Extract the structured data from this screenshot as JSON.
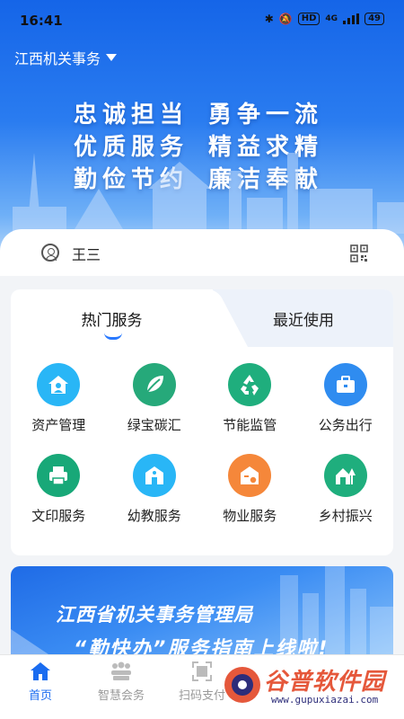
{
  "status": {
    "time": "16:41",
    "network": "4G",
    "battery": "49"
  },
  "header": {
    "region": "江西机关事务"
  },
  "slogans": [
    [
      "忠诚担当",
      "勇争一流"
    ],
    [
      "优质服务",
      "精益求精"
    ],
    [
      "勤俭节约",
      "廉洁奉献"
    ]
  ],
  "user": {
    "name": "王三"
  },
  "tabs": {
    "hot": "热门服务",
    "recent": "最近使用"
  },
  "services": [
    {
      "label": "资产管理",
      "icon": "house-user-icon",
      "color": "#29b6f6"
    },
    {
      "label": "绿宝碳汇",
      "icon": "leaf-icon",
      "color": "#26a97a"
    },
    {
      "label": "节能监管",
      "icon": "recycle-icon",
      "color": "#1fae7d"
    },
    {
      "label": "公务出行",
      "icon": "briefcase-icon",
      "color": "#2f8cf0"
    },
    {
      "label": "文印服务",
      "icon": "printer-icon",
      "color": "#18a878"
    },
    {
      "label": "幼教服务",
      "icon": "school-icon",
      "color": "#29b6f6"
    },
    {
      "label": "物业服务",
      "icon": "property-icon",
      "color": "#f5873a"
    },
    {
      "label": "乡村振兴",
      "icon": "village-icon",
      "color": "#1fae7d"
    }
  ],
  "banner": {
    "line1": "江西省机关事务管理局",
    "line2": "“勤快办”服务指南上线啦!"
  },
  "nav": [
    {
      "label": "首页",
      "icon": "home-icon",
      "active": true
    },
    {
      "label": "智慧会务",
      "icon": "meeting-icon",
      "active": false
    },
    {
      "label": "扫码支付",
      "icon": "scan-icon",
      "active": false
    }
  ],
  "watermark": {
    "title": "谷普软件园",
    "url": "www.gupuxiazai.com"
  },
  "colors": {
    "primary": "#1a6cf0",
    "hero_top": "#1565e8",
    "tab_bg": "#edf2fa"
  }
}
